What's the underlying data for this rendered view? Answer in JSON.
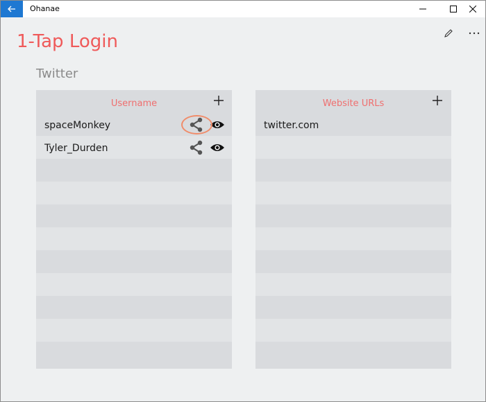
{
  "window": {
    "app_title": "Ohanae"
  },
  "page": {
    "title": "1-Tap Login",
    "section": "Twitter"
  },
  "username_panel": {
    "header": "Username",
    "rows": [
      "spaceMonkey",
      "Tyler_Durden",
      "",
      "",
      "",
      "",
      "",
      "",
      "",
      "",
      ""
    ]
  },
  "url_panel": {
    "header": "Website URLs",
    "rows": [
      "twitter.com",
      "",
      "",
      "",
      "",
      "",
      "",
      "",
      "",
      "",
      ""
    ]
  },
  "colors": {
    "accent": "#ef5a5a",
    "titlebar_back": "#1e78d2",
    "highlight": "#f08c6a"
  }
}
